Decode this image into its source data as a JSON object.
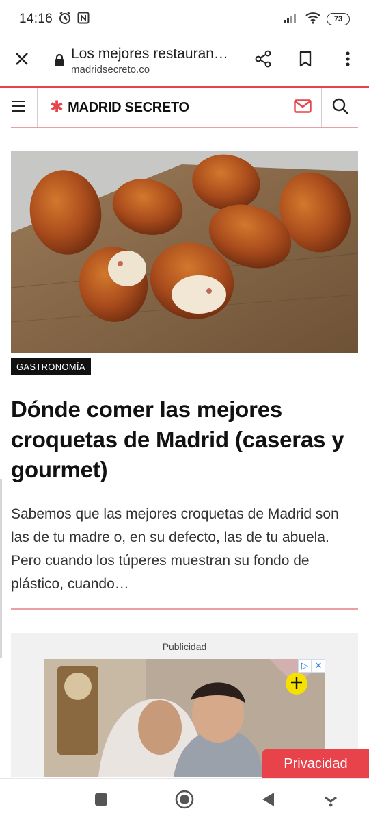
{
  "status_bar": {
    "time": "14:16",
    "battery_level": "73",
    "icons": [
      "alarm-icon",
      "nfc-icon",
      "signal-icon",
      "wifi-icon",
      "battery-icon"
    ]
  },
  "browser": {
    "page_title": "Los mejores restauran…",
    "domain": "madridsecreto.co",
    "icons": [
      "close-icon",
      "lock-icon",
      "share-icon",
      "bookmark-icon",
      "more-vert-icon"
    ]
  },
  "site": {
    "logo_star": "✱",
    "logo_text": "MADRID SECRETO",
    "icons": [
      "menu-icon",
      "mail-icon",
      "search-icon"
    ],
    "accent_color": "#e8424b"
  },
  "article": {
    "category": "GASTRONOMÍA",
    "headline": "Dónde comer las mejores croquetas de Madrid (caseras y gourmet)",
    "excerpt": "Sabemos que las mejores croquetas de Madrid son las de tu madre o, en su defecto, las de tu abuela. Pero cuando los túperes muestran su fondo de plástico, cuando…",
    "image_subject": "croquetas"
  },
  "ad": {
    "label": "Publicidad",
    "choices": [
      "▷",
      "✕"
    ]
  },
  "privacy": {
    "label": "Privacidad"
  },
  "navbar": {
    "icons": [
      "recents-square-icon",
      "home-circle-icon",
      "back-triangle-icon",
      "assistant-icon"
    ]
  }
}
